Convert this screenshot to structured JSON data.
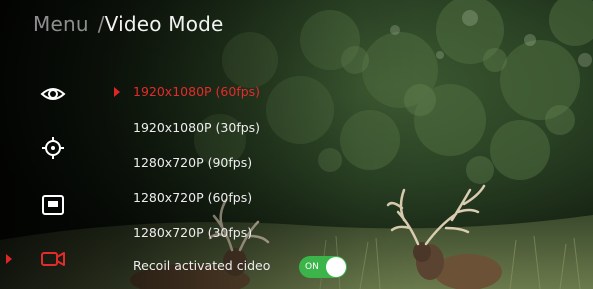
{
  "header": {
    "menu_label": "Menu",
    "separator": "/",
    "current_label": "Video Mode"
  },
  "sidebar": {
    "items": [
      {
        "icon": "eye-icon",
        "active": false
      },
      {
        "icon": "crosshair-icon",
        "active": false
      },
      {
        "icon": "image-frame-icon",
        "active": false
      },
      {
        "icon": "video-camera-icon",
        "active": true
      }
    ]
  },
  "video_modes": {
    "selected_index": 0,
    "options": [
      "1920x1080P (60fps)",
      "1920x1080P (30fps)",
      "1280x720P (90fps)",
      "1280x720P (60fps)",
      "1280x720P (30fps)"
    ]
  },
  "recoil_video": {
    "label": "Recoil activated cideo",
    "toggle_text": "ON",
    "enabled": true
  },
  "colors": {
    "accent": "#e32b2b",
    "toggle_on": "#3bb54a",
    "text": "#eeeeee",
    "breadcrumb_muted": "#8e8e8e"
  },
  "background": {
    "description_icon": "camera-live-view"
  }
}
